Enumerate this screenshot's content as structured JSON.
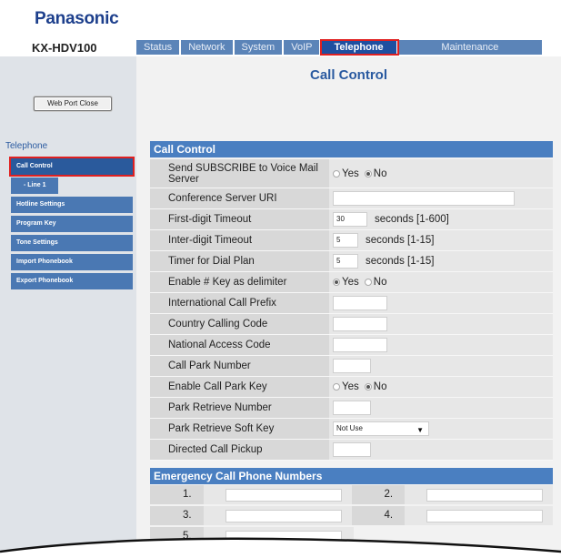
{
  "brand": "Panasonic",
  "model": "KX-HDV100",
  "tabs": [
    {
      "label": "Status"
    },
    {
      "label": "Network"
    },
    {
      "label": "System"
    },
    {
      "label": "VoIP"
    },
    {
      "label": "Telephone"
    },
    {
      "label": "Maintenance"
    }
  ],
  "sidebar": {
    "web_port_button": "Web Port Close",
    "heading": "Telephone",
    "items": [
      {
        "label": "Call Control"
      },
      {
        "label": "- Line 1"
      },
      {
        "label": "Hotline Settings"
      },
      {
        "label": "Program Key"
      },
      {
        "label": "Tone Settings"
      },
      {
        "label": "Import Phonebook"
      },
      {
        "label": "Export Phonebook"
      }
    ]
  },
  "page_title": "Call Control",
  "call_control": {
    "heading": "Call Control",
    "send_subscribe": {
      "label": "Send SUBSCRIBE to Voice Mail Server",
      "yes": "Yes",
      "no": "No",
      "selected": "No"
    },
    "conference_uri": {
      "label": "Conference Server URI",
      "value": ""
    },
    "first_digit": {
      "label": "First-digit Timeout",
      "value": "30",
      "unit": "seconds [1-600]"
    },
    "inter_digit": {
      "label": "Inter-digit Timeout",
      "value": "5",
      "unit": "seconds [1-15]"
    },
    "timer_dial_plan": {
      "label": "Timer for Dial Plan",
      "value": "5",
      "unit": "seconds [1-15]"
    },
    "hash_delimiter": {
      "label": "Enable # Key as delimiter",
      "yes": "Yes",
      "no": "No",
      "selected": "Yes"
    },
    "intl_prefix": {
      "label": "International Call Prefix",
      "value": ""
    },
    "country_code": {
      "label": "Country Calling Code",
      "value": ""
    },
    "national_access": {
      "label": "National Access Code",
      "value": ""
    },
    "call_park_number": {
      "label": "Call Park Number",
      "value": ""
    },
    "call_park_key": {
      "label": "Enable Call Park Key",
      "yes": "Yes",
      "no": "No",
      "selected": "No"
    },
    "park_retrieve_number": {
      "label": "Park Retrieve Number",
      "value": ""
    },
    "park_retrieve_soft_key": {
      "label": "Park Retrieve Soft Key",
      "value": "Not Use"
    },
    "directed_pickup": {
      "label": "Directed Call Pickup",
      "value": ""
    }
  },
  "emergency": {
    "heading": "Emergency Call Phone Numbers",
    "numbers": [
      "1.",
      "2.",
      "3.",
      "4.",
      "5."
    ]
  }
}
